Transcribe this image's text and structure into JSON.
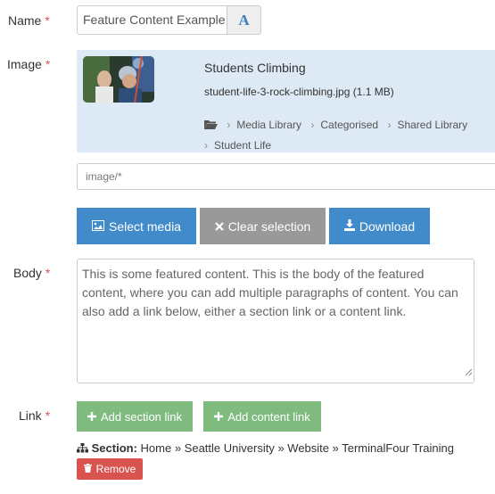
{
  "fields": {
    "name": {
      "label": "Name",
      "required": "*",
      "value": "Feature Content Example"
    },
    "image": {
      "label": "Image",
      "required": "*"
    },
    "body": {
      "label": "Body",
      "required": "*",
      "value": "This is some featured content. This is the body of the featured content, where you can add multiple paragraphs of content. You can also add a link below, either a section link or a content link."
    },
    "link": {
      "label": "Link",
      "required": "*"
    }
  },
  "media": {
    "title": "Students Climbing",
    "file": "student-life-3-rock-climbing.jpg (1.1 MB)",
    "breadcrumb": [
      "Media Library",
      "Categorised",
      "Shared Library",
      "Student Life"
    ],
    "mime_filter": "image/*"
  },
  "buttons": {
    "font": "A",
    "select_media": "Select media",
    "clear_selection": "Clear selection",
    "download": "Download",
    "add_section_link": "Add section link",
    "add_content_link": "Add content link",
    "remove": "Remove"
  },
  "section_link": {
    "label": "Section:",
    "path": "Home » Seattle University » Website » TerminalFour Training"
  },
  "colors": {
    "primary": "#428bca",
    "grey": "#999999",
    "success": "#7fbb7f",
    "danger": "#d9534f",
    "required": "#d9534f",
    "panel": "#dde9f4"
  },
  "icons": [
    "image-icon",
    "times-icon",
    "download-icon",
    "plus-icon",
    "sitemap-icon",
    "trash-icon",
    "folder-open-icon",
    "chevron-right-icon"
  ]
}
